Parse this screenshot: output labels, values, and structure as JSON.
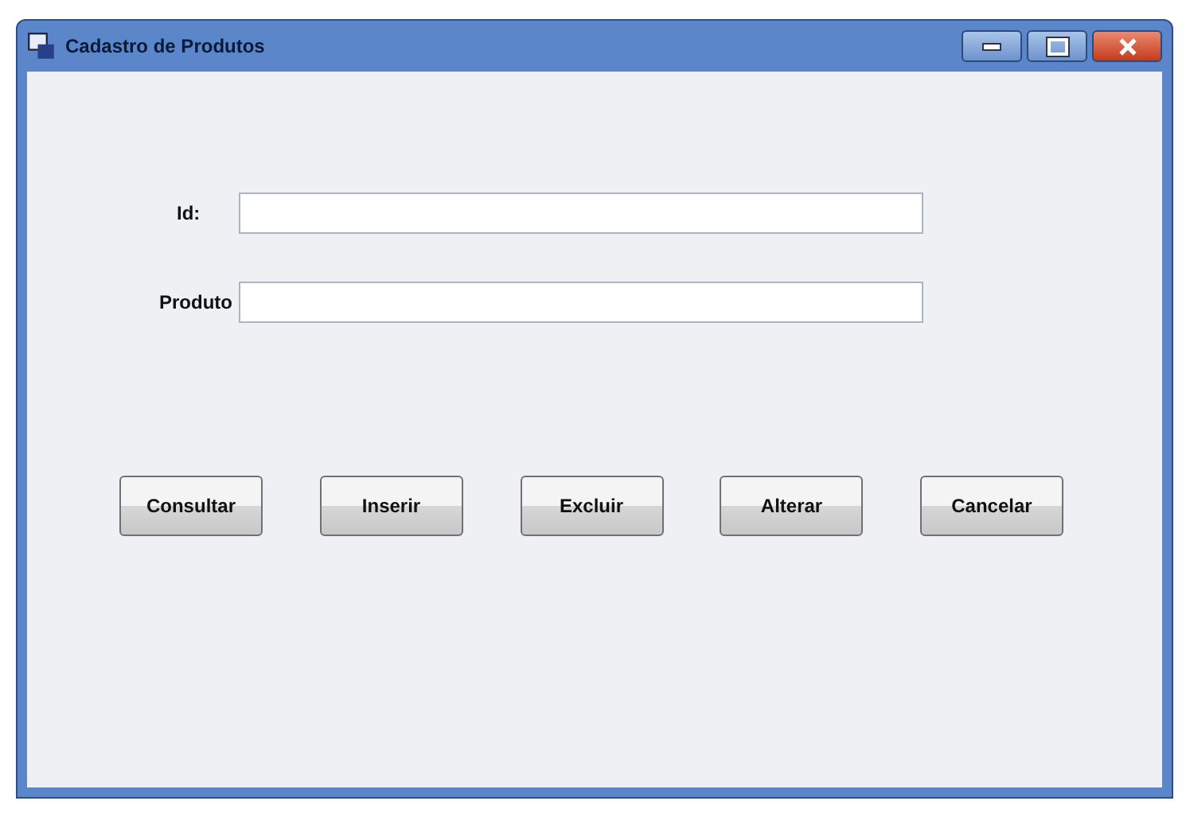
{
  "window": {
    "title": "Cadastro de Produtos"
  },
  "fields": [
    {
      "label": "Id:"
    },
    {
      "label": "Produto"
    }
  ],
  "buttons": [
    "Consultar",
    "Inserir",
    "Excluir",
    "Alterar",
    "Cancelar"
  ]
}
